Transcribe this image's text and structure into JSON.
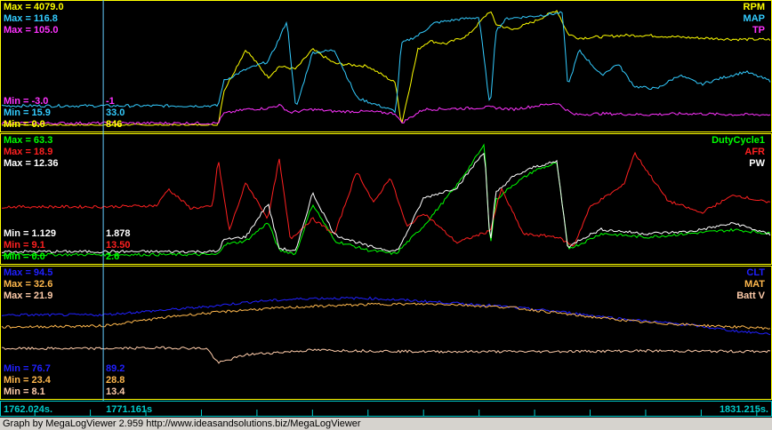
{
  "chart_data": [
    {
      "type": "line",
      "panel": "top",
      "series": [
        {
          "name": "RPM",
          "color": "#ffff00",
          "max_label": "Max = 4079.0",
          "min_label": "Min = 0.0",
          "cursor_value": "846",
          "min": 0,
          "max": 4079,
          "x": [
            1762.0,
            1767.0,
            1771.0,
            1776.0,
            1779.0,
            1781.5,
            1782.0,
            1784.0,
            1786.0,
            1787.0,
            1788.5,
            1790.0,
            1792.0,
            1795.0,
            1797.5,
            1798.0,
            1799.5,
            1800.5,
            1802.0,
            1804.0,
            1806.0,
            1806.5,
            1808.0,
            1810.0,
            1812.0,
            1813.0,
            1814.0,
            1816.0,
            1818.0,
            1820.0,
            1824.0,
            1828.0,
            1831.2
          ],
          "y": [
            0,
            0,
            0,
            0,
            0,
            0,
            1200,
            2700,
            1700,
            2100,
            2000,
            2700,
            2200,
            2100,
            1500,
            0,
            2700,
            3000,
            2900,
            3200,
            4079,
            3600,
            3400,
            3700,
            4100,
            3250,
            3100,
            3150,
            3200,
            3200,
            3120,
            3060,
            3050
          ]
        },
        {
          "name": "MAP",
          "color": "#33ccff",
          "max_label": "Max = 116.8",
          "min_label": "Min = 15.9",
          "cursor_value": "33.0",
          "min": 15.9,
          "max": 116.8,
          "x": [
            1762.0,
            1767.0,
            1771.0,
            1776.0,
            1779.0,
            1781.5,
            1782.0,
            1784.0,
            1786.0,
            1787.0,
            1787.7,
            1788.5,
            1790.0,
            1792.0,
            1794.0,
            1797.5,
            1798.0,
            1799.5,
            1801.0,
            1803.0,
            1805.0,
            1806.0,
            1806.5,
            1807.5,
            1810.0,
            1812.5,
            1813.0,
            1814.0,
            1816.0,
            1817.5,
            1819.0,
            1821.0,
            1823.0,
            1825.0,
            1827.0,
            1829.0,
            1831.2
          ],
          "y": [
            33,
            33,
            33,
            33,
            33,
            33,
            55,
            65,
            72,
            92,
            108,
            30,
            80,
            82,
            40,
            28,
            88,
            95,
            106,
            109,
            111,
            30,
            99,
            110,
            112,
            115,
            50,
            82,
            60,
            70,
            50,
            48,
            60,
            52,
            58,
            63,
            55
          ]
        },
        {
          "name": "TP",
          "color": "#ff33ff",
          "max_label": "Max = 105.0",
          "min_label": "Min = -3.0",
          "cursor_value": "-1",
          "min": -3,
          "max": 105,
          "x": [
            1762.0,
            1767.0,
            1771.0,
            1776.0,
            1779.0,
            1781.5,
            1782.0,
            1784.0,
            1786.0,
            1787.0,
            1788.0,
            1790.0,
            1792.0,
            1795.0,
            1797.5,
            1798.0,
            1800.0,
            1804.0,
            1806.0,
            1808.0,
            1812.0,
            1813.5,
            1816.0,
            1820.0,
            1824.0,
            1828.0,
            1831.2
          ],
          "y": [
            -1,
            -1,
            -1,
            -1,
            -1,
            -1,
            8,
            12,
            13,
            16,
            9,
            12,
            10,
            10,
            8,
            -1,
            12,
            13,
            14,
            12,
            18,
            7,
            8,
            7,
            8,
            7,
            7
          ]
        }
      ]
    },
    {
      "type": "line",
      "panel": "middle",
      "series": [
        {
          "name": "DutyCycle1",
          "color": "#00ff00",
          "max_label": "Max = 63.3",
          "min_label": "Min = 0.0",
          "cursor_value": "2.6",
          "min": 0,
          "max": 63.3,
          "x": [
            1762.0,
            1771.0,
            1781.5,
            1782.0,
            1784.0,
            1786.0,
            1787.0,
            1788.5,
            1790.0,
            1792.0,
            1795.0,
            1797.5,
            1798.0,
            1800.0,
            1803.0,
            1805.5,
            1806.0,
            1806.5,
            1808.0,
            1810.0,
            1812.0,
            1813.0,
            1814.0,
            1816.0,
            1820.0,
            1824.0,
            1828.0,
            1831.2
          ],
          "y": [
            2.6,
            2.6,
            2.6,
            8,
            10,
            20,
            5,
            3,
            30,
            10,
            5,
            3,
            6,
            18,
            40,
            62,
            6,
            32,
            40,
            48,
            52,
            6,
            8,
            14,
            12,
            14,
            16,
            14
          ]
        },
        {
          "name": "AFR",
          "color": "#ff2020",
          "max_label": "Max = 18.9",
          "min_label": "Min = 9.1",
          "cursor_value": "13.50",
          "min": 9.1,
          "max": 18.9,
          "x": [
            1762.0,
            1771.0,
            1776.0,
            1777.0,
            1779.0,
            1781.0,
            1781.5,
            1782.5,
            1784.0,
            1786.0,
            1787.0,
            1788.0,
            1790.0,
            1792.0,
            1794.0,
            1795.5,
            1797.0,
            1798.5,
            1800.0,
            1803.0,
            1806.0,
            1807.0,
            1809.0,
            1812.0,
            1813.5,
            1815.0,
            1818.0,
            1819.0,
            1822.0,
            1825.0,
            1828.0,
            1831.2
          ],
          "y": [
            13.5,
            13.5,
            13.6,
            15.0,
            13.4,
            13.5,
            17.5,
            11.5,
            15.5,
            12.5,
            17.5,
            10.8,
            12.5,
            11.2,
            16.5,
            13.8,
            16.0,
            11.8,
            13.0,
            10.5,
            11.5,
            15.0,
            11.2,
            11.0,
            10.2,
            13.5,
            15.3,
            18.0,
            14.0,
            13.0,
            14.5,
            13.8
          ]
        },
        {
          "name": "PW",
          "color": "#ffffff",
          "max_label": "Max = 12.36",
          "min_label": "Min = 1.129",
          "cursor_value": "1.878",
          "min": 1.129,
          "max": 12.36,
          "x": [
            1762.0,
            1771.0,
            1781.5,
            1782.0,
            1784.0,
            1786.0,
            1787.0,
            1788.5,
            1790.0,
            1792.0,
            1795.0,
            1797.5,
            1798.0,
            1800.0,
            1803.0,
            1805.5,
            1806.0,
            1806.5,
            1808.0,
            1810.0,
            1812.0,
            1813.0,
            1814.0,
            1816.0,
            1820.0,
            1824.0,
            1828.0,
            1831.2
          ],
          "y": [
            1.878,
            1.878,
            1.878,
            3.0,
            3.3,
            6.5,
            2.2,
            1.9,
            7.5,
            3.5,
            2.4,
            1.9,
            2.6,
            7.0,
            8.0,
            11.5,
            2.4,
            7.5,
            9.0,
            10.0,
            10.5,
            2.2,
            3.0,
            4.0,
            3.6,
            3.8,
            4.6,
            3.5
          ]
        }
      ]
    },
    {
      "type": "line",
      "panel": "bottom",
      "series": [
        {
          "name": "CLT",
          "color": "#2020ff",
          "max_label": "Max = 94.5",
          "min_label": "Min = 76.7",
          "cursor_value": "89.2",
          "min": 76.7,
          "max": 94.5,
          "x": [
            1762.0,
            1771.0,
            1780.0,
            1785.0,
            1790.0,
            1795.0,
            1800.0,
            1806.0,
            1812.0,
            1818.0,
            1824.0,
            1828.0,
            1831.2
          ],
          "y": [
            89.2,
            89.2,
            90.5,
            91.5,
            92.0,
            92.0,
            91.5,
            90.8,
            89.8,
            88.5,
            87.5,
            86.5,
            86.0
          ]
        },
        {
          "name": "MAT",
          "color": "#ffb84d",
          "max_label": "Max = 32.6",
          "min_label": "Min = 23.4",
          "cursor_value": "28.8",
          "min": 23.4,
          "max": 32.6,
          "x": [
            1762.0,
            1771.0,
            1778.0,
            1784.0,
            1790.0,
            1796.0,
            1802.0,
            1808.0,
            1814.0,
            1820.0,
            1826.0,
            1831.2
          ],
          "y": [
            28.8,
            28.9,
            29.8,
            30.3,
            30.6,
            30.8,
            30.8,
            30.5,
            29.8,
            29.2,
            28.9,
            28.7
          ]
        },
        {
          "name": "Batt V",
          "color": "#ffccaa",
          "max_label": "Max = 21.9",
          "min_label": "Min = 8.1",
          "cursor_value": "13.4",
          "min": 8.1,
          "max": 21.9,
          "x": [
            1762.0,
            1771.0,
            1777.0,
            1780.5,
            1781.5,
            1784.0,
            1790.0,
            1800.0,
            1810.0,
            1820.0,
            1831.2
          ],
          "y": [
            13.4,
            13.4,
            13.5,
            13.4,
            11.5,
            12.6,
            13.2,
            13.0,
            13.0,
            13.1,
            13.0
          ]
        }
      ]
    }
  ],
  "axis": {
    "x_start": 1762.024,
    "x_end": 1831.215,
    "cursor": 1771.161,
    "start_label": "1762.024s.",
    "cursor_label": "1771.161s",
    "end_label": "1831.215s."
  },
  "footer": "Graph by MegaLogViewer 2.959 http://www.ideasandsolutions.biz/MegaLogViewer",
  "colors": {
    "background": "#000000",
    "border": "#ffff00",
    "cursor": "#66ccff",
    "axis": "#00cccc"
  }
}
